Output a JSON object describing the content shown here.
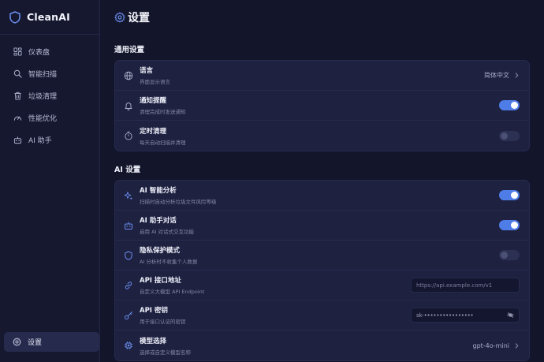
{
  "app": {
    "name": "CleanAI"
  },
  "nav": {
    "items": [
      {
        "key": "dashboard",
        "label": "仪表盘",
        "icon": "dashboard-icon"
      },
      {
        "key": "smart-scan",
        "label": "智能扫描",
        "icon": "search-icon"
      },
      {
        "key": "junk-clean",
        "label": "垃圾清理",
        "icon": "trash-icon"
      },
      {
        "key": "performance",
        "label": "性能优化",
        "icon": "gauge-icon"
      },
      {
        "key": "ai-assistant",
        "label": "AI 助手",
        "icon": "robot-icon"
      }
    ],
    "settings_label": "设置"
  },
  "page": {
    "title": "设置"
  },
  "general": {
    "title": "通用设置",
    "language": {
      "label": "语言",
      "desc": "界面显示语言",
      "value": "简体中文"
    },
    "notify": {
      "label": "通知提醒",
      "desc": "清理完成时发送通知",
      "enabled": true
    },
    "schedule": {
      "label": "定时清理",
      "desc": "每天自动扫描并清理",
      "enabled": false
    }
  },
  "ai": {
    "title": "AI 设置",
    "analysis": {
      "label": "AI 智能分析",
      "desc": "扫描时自动分析垃圾文件风险等级",
      "enabled": true
    },
    "chat": {
      "label": "AI 助手对话",
      "desc": "启用 AI 对话式交互功能",
      "enabled": true
    },
    "privacy": {
      "label": "隐私保护模式",
      "desc": "AI 分析时不收集个人数据",
      "enabled": false
    },
    "api_url": {
      "label": "API 接口地址",
      "desc": "自定义大模型 API Endpoint",
      "placeholder": "https://api.example.com/v1"
    },
    "api_key": {
      "label": "API 密钥",
      "desc": "用于接口认证的密钥",
      "value": "sk-••••••••••••••••"
    },
    "model": {
      "label": "模型选择",
      "desc": "选择或自定义模型名称",
      "value": "gpt-4o-mini"
    }
  },
  "colors": {
    "accent": "#4f7de8",
    "background": "#13152a",
    "card": "#1e2140"
  }
}
